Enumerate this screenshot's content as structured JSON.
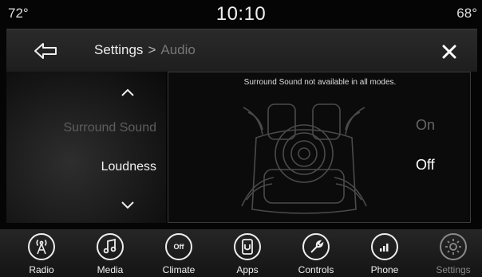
{
  "status": {
    "temp_left": "72°",
    "clock": "10:10",
    "temp_right": "68°"
  },
  "header": {
    "back_icon": "back-arrow-icon",
    "breadcrumb_section": "Settings",
    "breadcrumb_separator": ">",
    "breadcrumb_page": "Audio",
    "close_icon": "close-icon"
  },
  "menu": {
    "items": [
      {
        "label": "Surround Sound",
        "state": "dimmed"
      },
      {
        "label": "Loudness",
        "state": "selected"
      }
    ]
  },
  "panel": {
    "note": "Surround Sound not available in all modes.",
    "options": [
      {
        "label": "On",
        "active": false
      },
      {
        "label": "Off",
        "active": true
      }
    ]
  },
  "nav": {
    "items": [
      {
        "label": "Radio",
        "icon": "radio-antenna-icon"
      },
      {
        "label": "Media",
        "icon": "music-note-icon"
      },
      {
        "label": "Climate",
        "icon": "climate-off-icon",
        "icon_text": "Off"
      },
      {
        "label": "Apps",
        "icon": "apps-icon"
      },
      {
        "label": "Controls",
        "icon": "wrench-icon"
      },
      {
        "label": "Phone",
        "icon": "phone-signal-icon"
      },
      {
        "label": "Settings",
        "icon": "gear-icon",
        "active": true
      }
    ]
  },
  "colors": {
    "active_text": "#ffffff",
    "dimmed_text": "#5e5e5e",
    "header_bg": "#222222"
  }
}
